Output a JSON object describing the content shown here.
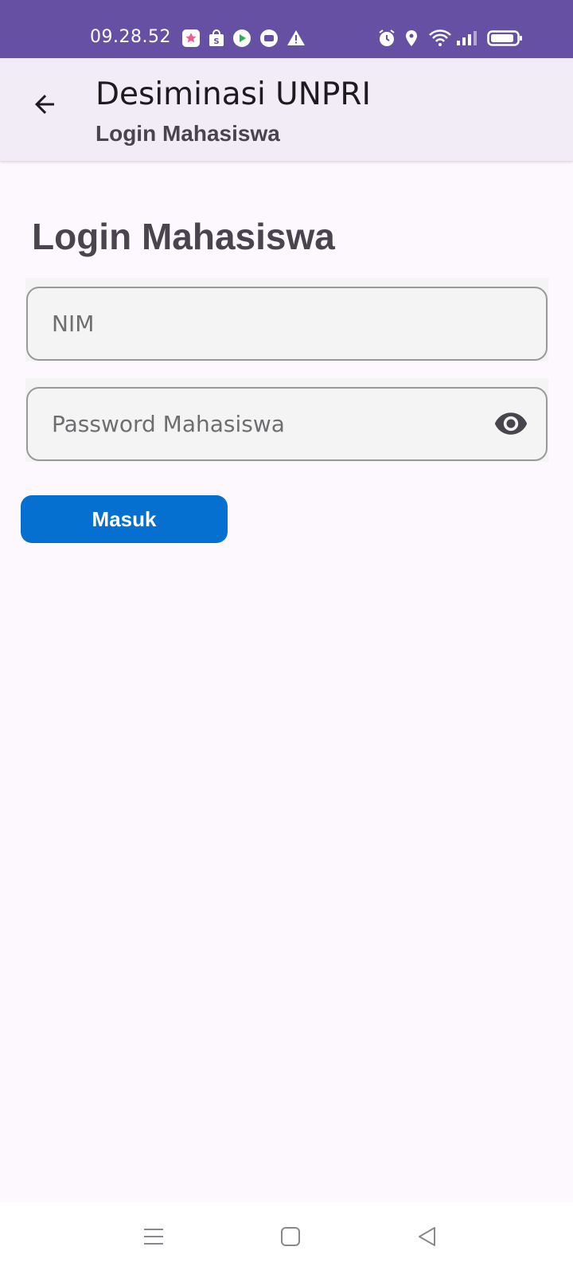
{
  "status_bar": {
    "time": "09.28.52",
    "left_icons": [
      "photos-app-icon",
      "shopee-icon",
      "play-store-icon",
      "chat-icon",
      "warning-icon"
    ],
    "right_icons": [
      "alarm-icon",
      "location-icon",
      "wifi-icon",
      "signal-icon",
      "battery-icon"
    ],
    "background": "#6650a4"
  },
  "app_bar": {
    "title": "Desiminasi UNPRI",
    "subtitle": "Login Mahasiswa",
    "back_icon": "arrow-left-icon"
  },
  "main": {
    "heading": "Login Mahasiswa",
    "nim_field": {
      "placeholder": "NIM",
      "value": ""
    },
    "password_field": {
      "placeholder": "Password Mahasiswa",
      "value": "",
      "toggle_icon": "eye-icon"
    },
    "login_button_label": "Masuk",
    "accent_color": "#0570d0"
  },
  "nav_bar": {
    "icons": [
      "menu-icon",
      "home-square-icon",
      "back-triangle-icon"
    ]
  }
}
